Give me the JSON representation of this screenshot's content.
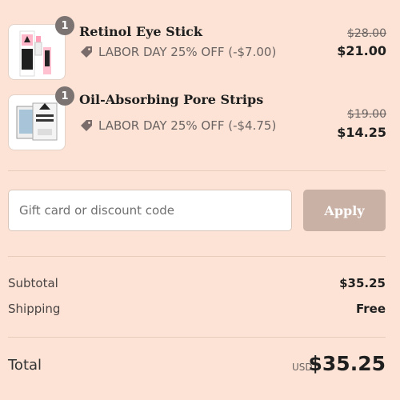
{
  "colors": {
    "background": "#fde3d5",
    "badge": "#7a7372",
    "apply_button": "#c9b1a5",
    "text_dark": "#1f1f1f"
  },
  "items": [
    {
      "name": "Retinol Eye Stick",
      "quantity": "1",
      "discount_label": "LABOR DAY 25% OFF (-$7.00)",
      "original_price": "$28.00",
      "final_price": "$21.00",
      "icon": "price-tag-icon"
    },
    {
      "name": "Oil-Absorbing Pore Strips",
      "quantity": "1",
      "discount_label": "LABOR DAY 25% OFF (-$4.75)",
      "original_price": "$19.00",
      "final_price": "$14.25",
      "icon": "price-tag-icon"
    }
  ],
  "discount": {
    "placeholder": "Gift card or discount code",
    "apply_label": "Apply"
  },
  "summary": {
    "subtotal_label": "Subtotal",
    "subtotal_value": "$35.25",
    "shipping_label": "Shipping",
    "shipping_value": "Free"
  },
  "total": {
    "label": "Total",
    "currency": "USD",
    "value": "$35.25"
  }
}
